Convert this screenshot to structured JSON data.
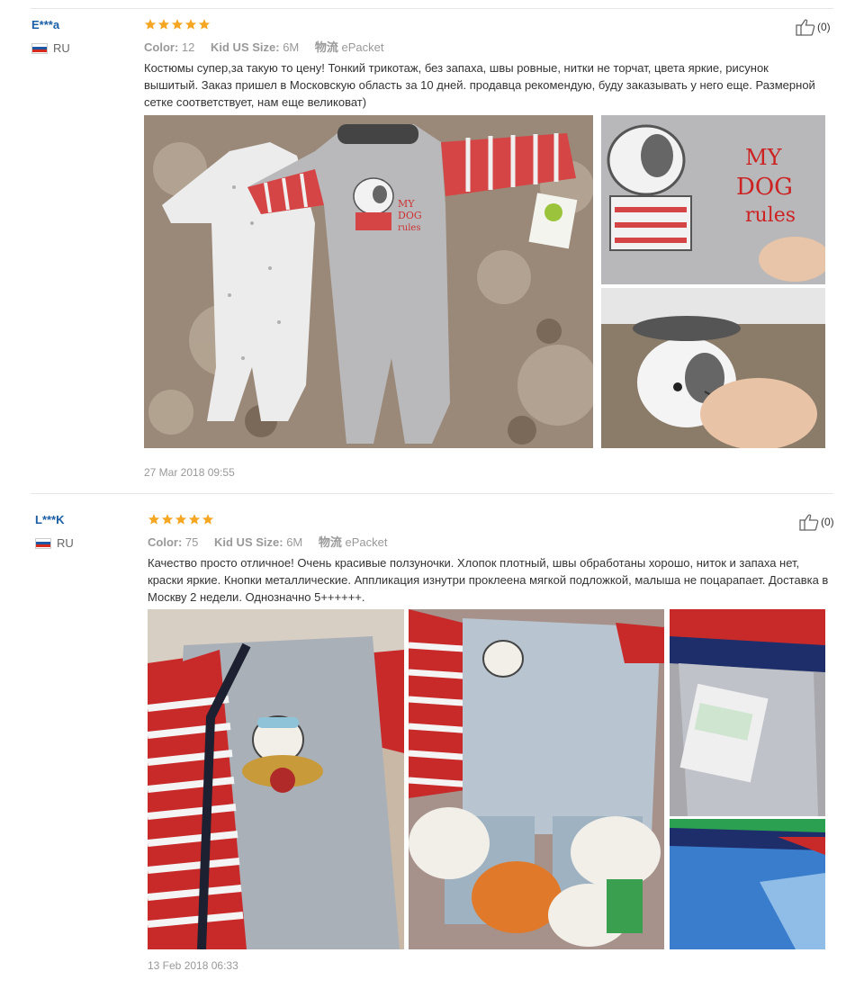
{
  "reviews": [
    {
      "user": "E***a",
      "country": "RU",
      "rating": 5,
      "color_label": "Color:",
      "color_value": "12",
      "size_label": "Kid US Size:",
      "size_value": "6M",
      "shipping_label": "物流",
      "shipping_value": "ePacket",
      "text": "Костюмы супер,за такую то цену! Тонкий трикотаж, без запаха, швы ровные, нитки не торчат, цвета яркие, рисунок вышитый. Заказ пришел в Московскую область за 10 дней. продавца рекомендую, буду заказывать у него еще. Размерной сетке соответствует, нам еще великоват)",
      "likes": "(0)",
      "date": "27 Mar 2018 09:55",
      "photo_text": "MY DOG rules"
    },
    {
      "user": "L***K",
      "country": "RU",
      "rating": 5,
      "color_label": "Color:",
      "color_value": "75",
      "size_label": "Kid US Size:",
      "size_value": "6M",
      "shipping_label": "物流",
      "shipping_value": "ePacket",
      "text": "Качество просто отличное! Очень красивые ползуночки. Хлопок плотный, швы обработаны хорошо, ниток и запаха нет, краски яркие. Кнопки металлические. Аппликация изнутри проклеена мягкой подложкой, малыша не поцарапает. Доставка в Москву 2 недели. Однозначно 5++++++.",
      "likes": "(0)",
      "date": "13 Feb 2018 06:33"
    }
  ],
  "colors": {
    "star": "#f5a623",
    "name_link": "#1a5ea6",
    "muted": "#999999",
    "flag_white": "#ffffff",
    "flag_blue": "#1c57a5",
    "flag_red": "#d52b1e"
  },
  "icons": {
    "like": "thumbs-up-icon",
    "flag": "russia-flag-icon",
    "star": "star-icon"
  }
}
